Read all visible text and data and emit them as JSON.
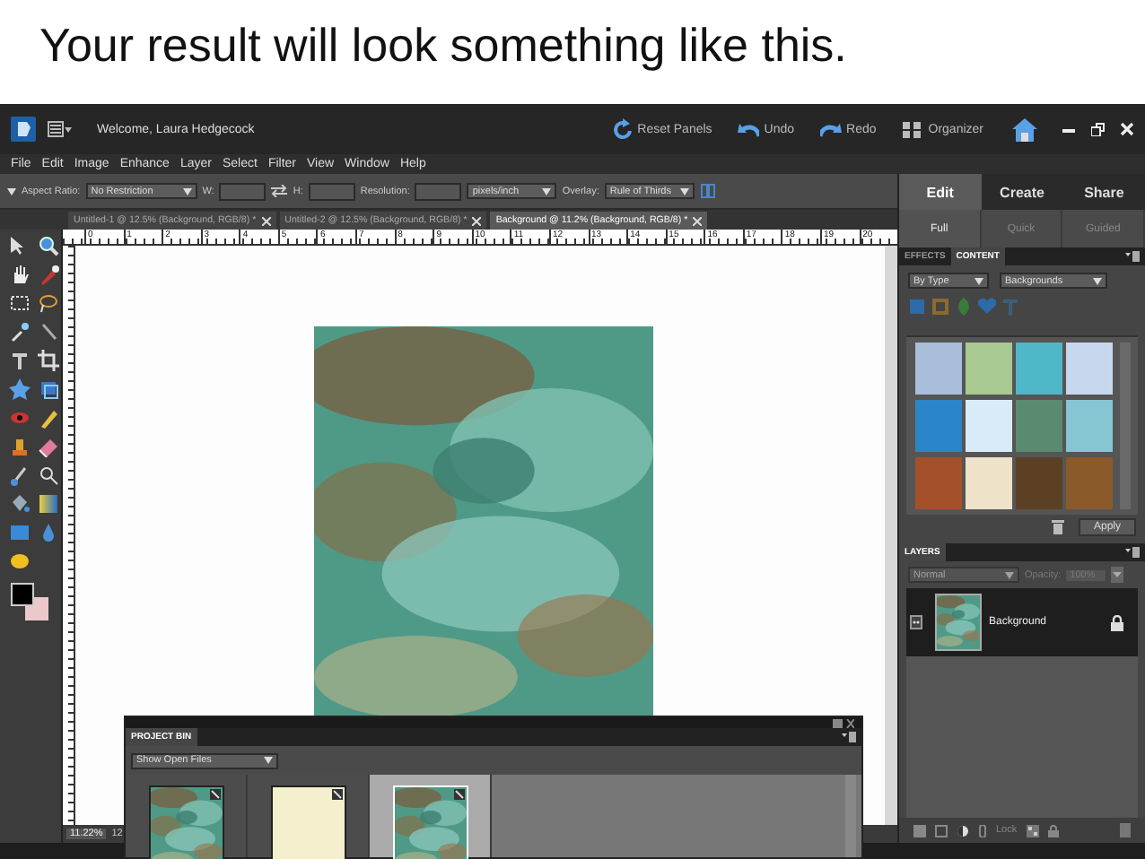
{
  "slide": {
    "title": "Your result will look something like this."
  },
  "window": {
    "title": "Welcome, Laura Hedgecock",
    "actions": [
      {
        "label": "Reset Panels",
        "kind": "reset"
      },
      {
        "label": "Undo",
        "kind": "undo"
      },
      {
        "label": "Redo",
        "kind": "redo"
      },
      {
        "label": "Organizer",
        "kind": "organizer"
      }
    ]
  },
  "menu": [
    "File",
    "Edit",
    "Image",
    "Enhance",
    "Layer",
    "Select",
    "Filter",
    "View",
    "Window",
    "Help"
  ],
  "options_bar": {
    "aspect_label": "Aspect Ratio:",
    "aspect_value": "No Restriction",
    "width_label": "W:",
    "height_label": "H:",
    "resolution_label": "Resolution:",
    "resolution_unit": "pixels/inch",
    "overlay_label": "Overlay:",
    "overlay_value": "Rule of Thirds"
  },
  "document_tabs": [
    {
      "label": "Untitled-1 @ 12.5% (Background, RGB/8) *",
      "selected": false
    },
    {
      "label": "Untitled-2 @ 12.5% (Background, RGB/8) *",
      "selected": false
    },
    {
      "label": "Background @ 11.2% (Background, RGB/8) *",
      "selected": true
    }
  ],
  "ruler_marks": [
    "0",
    "1",
    "2",
    "3",
    "4",
    "5",
    "6",
    "7",
    "8",
    "9",
    "10",
    "11",
    "12",
    "13",
    "14",
    "15",
    "16",
    "17",
    "18",
    "19",
    "20"
  ],
  "status_bar": {
    "zoom": "11.22%",
    "size": "12"
  },
  "mode_tabs": [
    {
      "label": "Edit",
      "selected": true
    },
    {
      "label": "Create",
      "selected": false
    },
    {
      "label": "Share",
      "selected": false
    }
  ],
  "edit_tabs": [
    {
      "label": "Full",
      "selected": true
    },
    {
      "label": "Quick",
      "selected": false
    },
    {
      "label": "Guided",
      "selected": false
    }
  ],
  "panel_tabs": [
    {
      "label": "EFFECTS",
      "selected": false
    },
    {
      "label": "CONTENT",
      "selected": true
    }
  ],
  "content_filters": [
    "By Type",
    "Backgrounds"
  ],
  "content_items": [
    {
      "color": "#a9bedb"
    },
    {
      "color": "#a8c991"
    },
    {
      "color": "#4fb7c8"
    },
    {
      "color": "#c7d8ee"
    },
    {
      "color": "#2a86c9"
    },
    {
      "color": "#d9ebf7"
    },
    {
      "color": "#5a8a70"
    },
    {
      "color": "#86c6d2"
    },
    {
      "color": "#a4502a"
    },
    {
      "color": "#eee2c8"
    },
    {
      "color": "#5c4023"
    },
    {
      "color": "#8a5a2a"
    }
  ],
  "apply_button": "Apply",
  "layers": {
    "title": "LAYERS",
    "blend_mode": "Normal",
    "opacity_label": "Opacity:",
    "opacity": "100%",
    "lock_label": "Lock",
    "items": [
      {
        "name": "Background",
        "selected": true,
        "locked": true
      }
    ]
  },
  "project_bin": {
    "title": "PROJECT BIN",
    "filter": "Show Open Files",
    "items": [
      {
        "kind": "texture",
        "selected": false
      },
      {
        "kind": "paper",
        "selected": false
      },
      {
        "kind": "texture",
        "selected": true
      }
    ]
  }
}
